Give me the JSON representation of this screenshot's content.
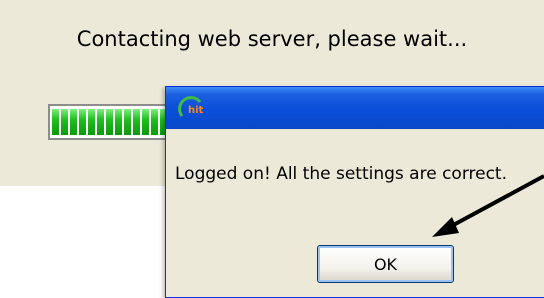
{
  "progress_window": {
    "message": "Contacting web server, please wait...",
    "progress_percent": 100
  },
  "dialog": {
    "app_icon": "hit-app-icon",
    "icon_text": "hit",
    "message": "Logged on! All the settings are correct.",
    "ok_label": "OK"
  },
  "colors": {
    "title_bar": "#0a4ed8",
    "window_face": "#ece9d8",
    "progress_green": "#20c020",
    "arrow": "#000000"
  }
}
